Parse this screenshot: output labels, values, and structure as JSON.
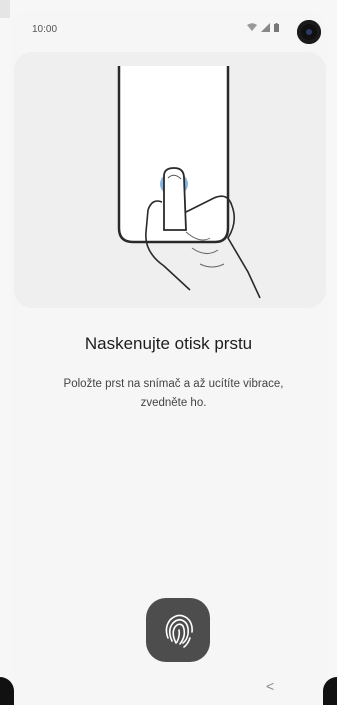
{
  "status_bar": {
    "time": "10:00",
    "icons": [
      "wifi-icon",
      "signal-icon",
      "battery-icon"
    ]
  },
  "illustration": {
    "icon": "finger-on-phone-illustration"
  },
  "main": {
    "title": "Naskenujte otisk prstu",
    "instruction": "Položte prst na snímač a až ucítíte vibrace, zvedněte ho."
  },
  "fingerprint_button": {
    "icon": "fingerprint-icon"
  },
  "nav_bar": {
    "back_glyph": "<"
  },
  "colors": {
    "accent": "#3f86c9",
    "button_bg": "#4d4d4d",
    "screen_bg": "#f6f6f6"
  }
}
